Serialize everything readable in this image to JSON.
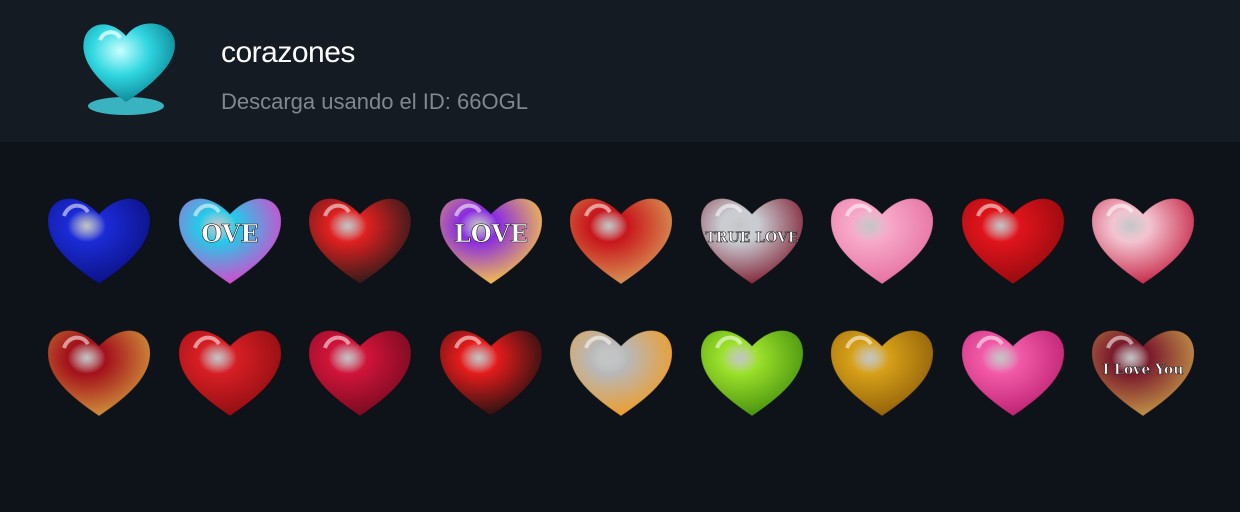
{
  "pack": {
    "title": "corazones",
    "download_text": "Descarga usando el ID: 66OGL",
    "icon": "cyan-glass-heart-icon"
  },
  "stickers": [
    {
      "name": "blue-glass-heart",
      "colors": [
        "#1b2bd6",
        "#0a0f7a"
      ],
      "text": ""
    },
    {
      "name": "rainbow-love-heart",
      "colors": [
        "#26c9e8",
        "#e83cc8"
      ],
      "text": "OVE"
    },
    {
      "name": "heart-music-note",
      "colors": [
        "#e02020",
        "#1a1a1a"
      ],
      "text": ""
    },
    {
      "name": "love-balloon-heart",
      "colors": [
        "#8a2be2",
        "#ffd23a"
      ],
      "text": "LOVE"
    },
    {
      "name": "red-floral-heart",
      "colors": [
        "#c8161b",
        "#d9a35a"
      ],
      "text": ""
    },
    {
      "name": "true-love-silver-hearts",
      "colors": [
        "#c9ccd2",
        "#7a1428"
      ],
      "text": "TRUE LOVE"
    },
    {
      "name": "pink-heart-box",
      "colors": [
        "#f7a9c9",
        "#e46b9e"
      ],
      "text": ""
    },
    {
      "name": "red-heart-cluster",
      "colors": [
        "#e0141b",
        "#8d0a0f"
      ],
      "text": ""
    },
    {
      "name": "crystal-rose-heart",
      "colors": [
        "#f3c3d0",
        "#c2183a"
      ],
      "text": ""
    },
    {
      "name": "ornate-red-gold-heart",
      "colors": [
        "#a3101a",
        "#d4a040"
      ],
      "text": ""
    },
    {
      "name": "hearts-gift-box",
      "colors": [
        "#d61f24",
        "#8a0c10"
      ],
      "text": ""
    },
    {
      "name": "red-glass-heart",
      "colors": [
        "#d0143a",
        "#6e0a1e"
      ],
      "text": ""
    },
    {
      "name": "angel-devil-heart",
      "colors": [
        "#e41b1b",
        "#111111"
      ],
      "text": ""
    },
    {
      "name": "winged-flaming-heart",
      "colors": [
        "#b8b8b8",
        "#f49a1a"
      ],
      "text": ""
    },
    {
      "name": "green-glass-heart",
      "colors": [
        "#9be02a",
        "#3f8a0c"
      ],
      "text": ""
    },
    {
      "name": "golden-rose-heart",
      "colors": [
        "#d6a018",
        "#8a5a08"
      ],
      "text": ""
    },
    {
      "name": "pink-heart-padlocks",
      "colors": [
        "#f25aa8",
        "#b81d6c"
      ],
      "text": ""
    },
    {
      "name": "i-love-you-key-heart",
      "colors": [
        "#7a1a2c",
        "#c9a24a"
      ],
      "text": "I Love You"
    }
  ]
}
